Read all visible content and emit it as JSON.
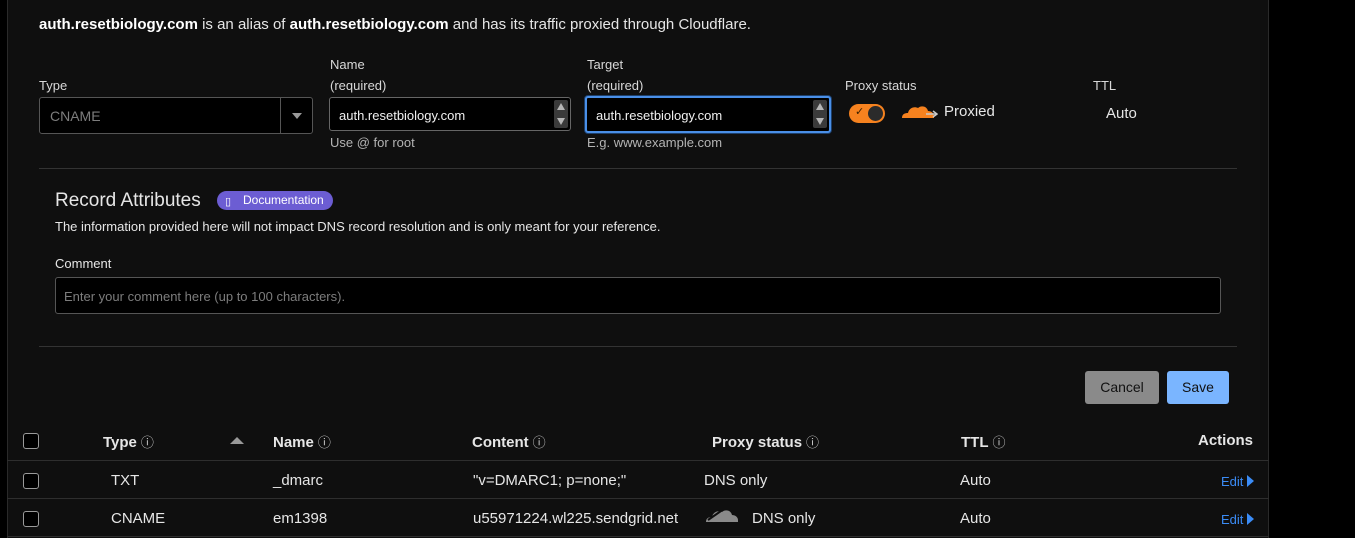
{
  "alias_notice": {
    "host": "auth.resetbiology.com",
    "text1": "is an alias of",
    "target": "auth.resetbiology.com",
    "text2": "and has its traffic proxied through Cloudflare."
  },
  "form": {
    "type_label": "Type",
    "type_value": "CNAME",
    "name_label": "Name",
    "name_required": "(required)",
    "name_value": "auth.resetbiology.com",
    "name_hint": "Use @ for root",
    "target_label": "Target",
    "target_required": "(required)",
    "target_value": "auth.resetbiology.com",
    "target_hint": "E.g. www.example.com",
    "proxy_label": "Proxy status",
    "proxy_on": true,
    "proxy_value": "Proxied",
    "ttl_label": "TTL",
    "ttl_value": "Auto"
  },
  "record_attributes": {
    "title": "Record Attributes",
    "doc_badge": "Documentation",
    "description": "The information provided here will not impact DNS record resolution and is only meant for your reference.",
    "comment_label": "Comment",
    "comment_placeholder": "Enter your comment here (up to 100 characters)."
  },
  "buttons": {
    "cancel": "Cancel",
    "save": "Save"
  },
  "table": {
    "headers": {
      "type": "Type",
      "name": "Name",
      "content": "Content",
      "proxy": "Proxy status",
      "ttl": "TTL",
      "actions": "Actions"
    },
    "info_icon": "ⓘ",
    "rows": [
      {
        "type": "TXT",
        "name": "_dmarc",
        "content": "\"v=DMARC1; p=none;\"",
        "proxy": "DNS only",
        "ttl": "Auto",
        "action": "Edit"
      },
      {
        "type": "CNAME",
        "name": "em1398",
        "content": "u55971224.wl225.sendgrid.net",
        "proxy": "DNS only",
        "ttl": "Auto",
        "action": "Edit"
      }
    ]
  },
  "colors": {
    "accent_orange": "#f6821f",
    "link_blue": "#3b8cf6",
    "save_blue": "#7ab5ff",
    "badge_purple": "#6c5dd3"
  }
}
